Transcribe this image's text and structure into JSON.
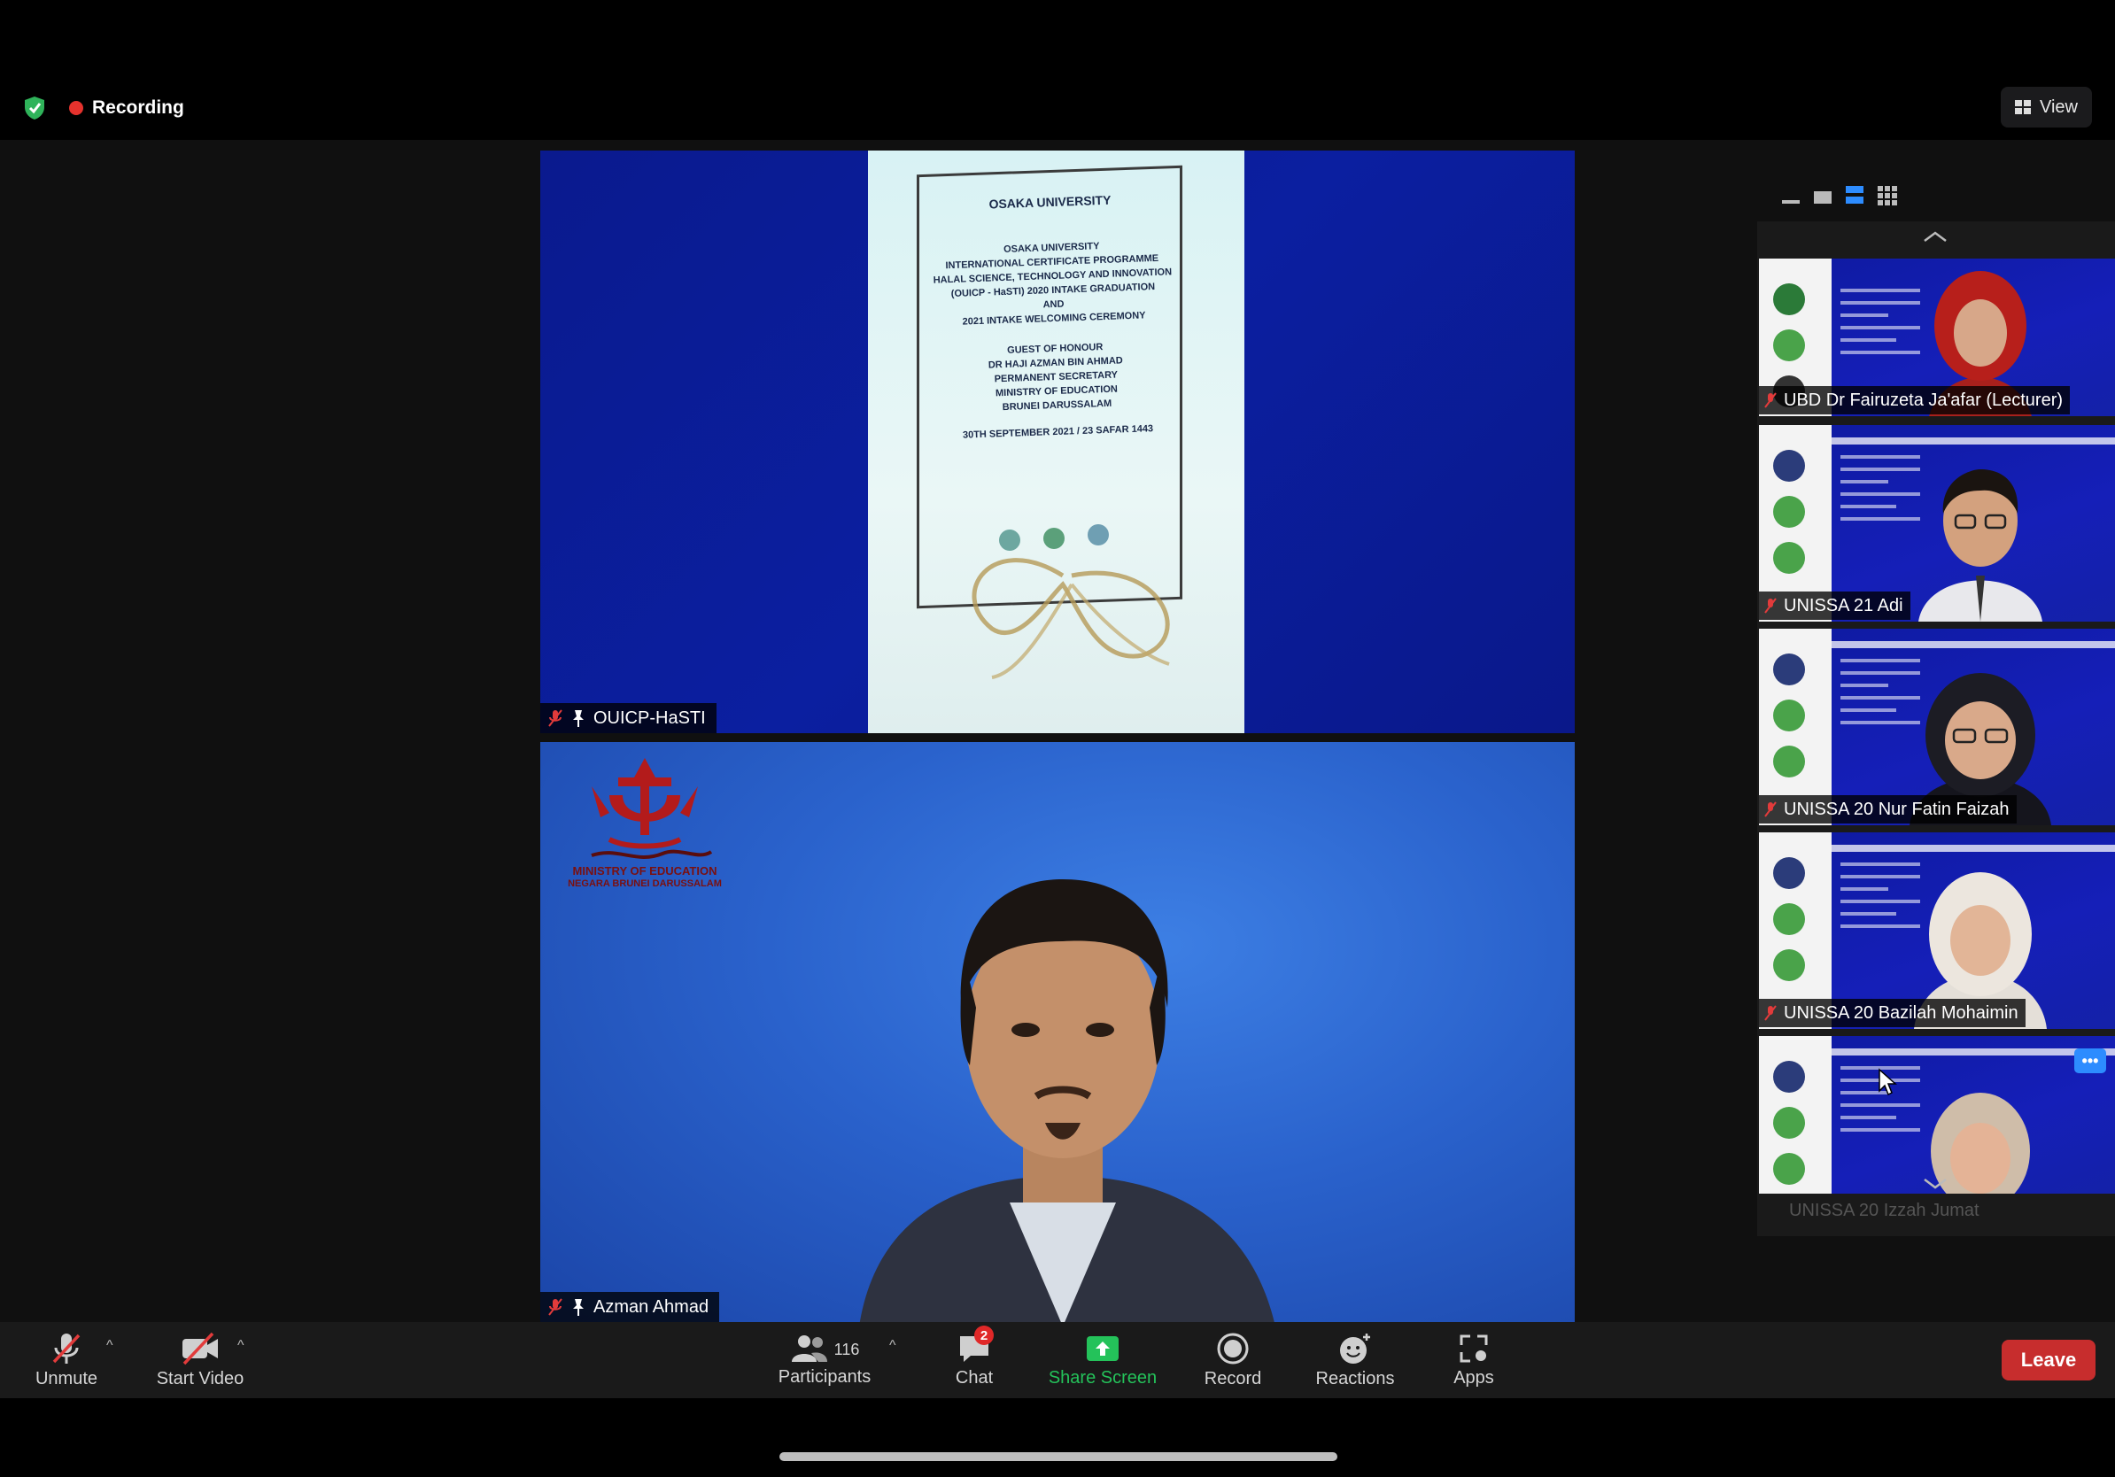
{
  "window": {
    "recording_label": "Recording",
    "view_label": "View"
  },
  "colors": {
    "accent_blue": "#2d8cff",
    "recording_red": "#e5322d",
    "share_green": "#24c25a",
    "leave_red": "#c72d2d",
    "security_green": "#2fb35a"
  },
  "main_tiles": [
    {
      "participant_name": "OUICP-HaSTI",
      "muted": true,
      "pinned": true,
      "content": {
        "logo_text": "OSAKA UNIVERSITY",
        "lines": [
          "OSAKA UNIVERSITY",
          "INTERNATIONAL CERTIFICATE PROGRAMME",
          "HALAL SCIENCE, TECHNOLOGY AND INNOVATION",
          "(OUICP - HaSTI) 2020 INTAKE GRADUATION",
          "AND",
          "2021 INTAKE WELCOMING CEREMONY",
          "",
          "GUEST OF HONOUR",
          "DR HAJI AZMAN BIN AHMAD",
          "PERMANENT SECRETARY",
          "MINISTRY OF EDUCATION",
          "BRUNEI DARUSSALAM",
          "",
          "30TH SEPTEMBER 2021 / 23 SAFAR 1443"
        ]
      }
    },
    {
      "participant_name": "Azman Ahmad",
      "muted": true,
      "pinned": true,
      "content": {
        "logo_line1": "MINISTRY OF EDUCATION",
        "logo_line2": "NEGARA BRUNEI DARUSSALAM"
      }
    }
  ],
  "thumbnails": [
    {
      "name": "UBD Dr Fairuzeta Ja'afar (Lecturer)",
      "muted": true
    },
    {
      "name": "UNISSA 21 Adi",
      "muted": true
    },
    {
      "name": "UNISSA 20 Nur Fatin Faizah",
      "muted": true
    },
    {
      "name": "UNISSA 20 Bazilah Mohaimin",
      "muted": true
    },
    {
      "name": "UNISSA 20 Izzah Jumat",
      "muted": true,
      "hovered": true,
      "more_label": "•••"
    }
  ],
  "toolbar": {
    "unmute_label": "Unmute",
    "start_video_label": "Start Video",
    "participants_label": "Participants",
    "participants_count": "116",
    "chat_label": "Chat",
    "chat_badge": "2",
    "share_screen_label": "Share Screen",
    "record_label": "Record",
    "reactions_label": "Reactions",
    "apps_label": "Apps",
    "leave_label": "Leave",
    "caret": "^"
  },
  "icons": {
    "security": "shield-check-icon",
    "view": "grid-view-icon",
    "mic": "mic-muted-icon",
    "video": "video-off-icon",
    "participants": "people-icon",
    "chat": "chat-bubble-icon",
    "share": "share-screen-icon",
    "record": "record-icon",
    "reactions": "emoji-plus-icon",
    "apps": "apps-icon"
  }
}
